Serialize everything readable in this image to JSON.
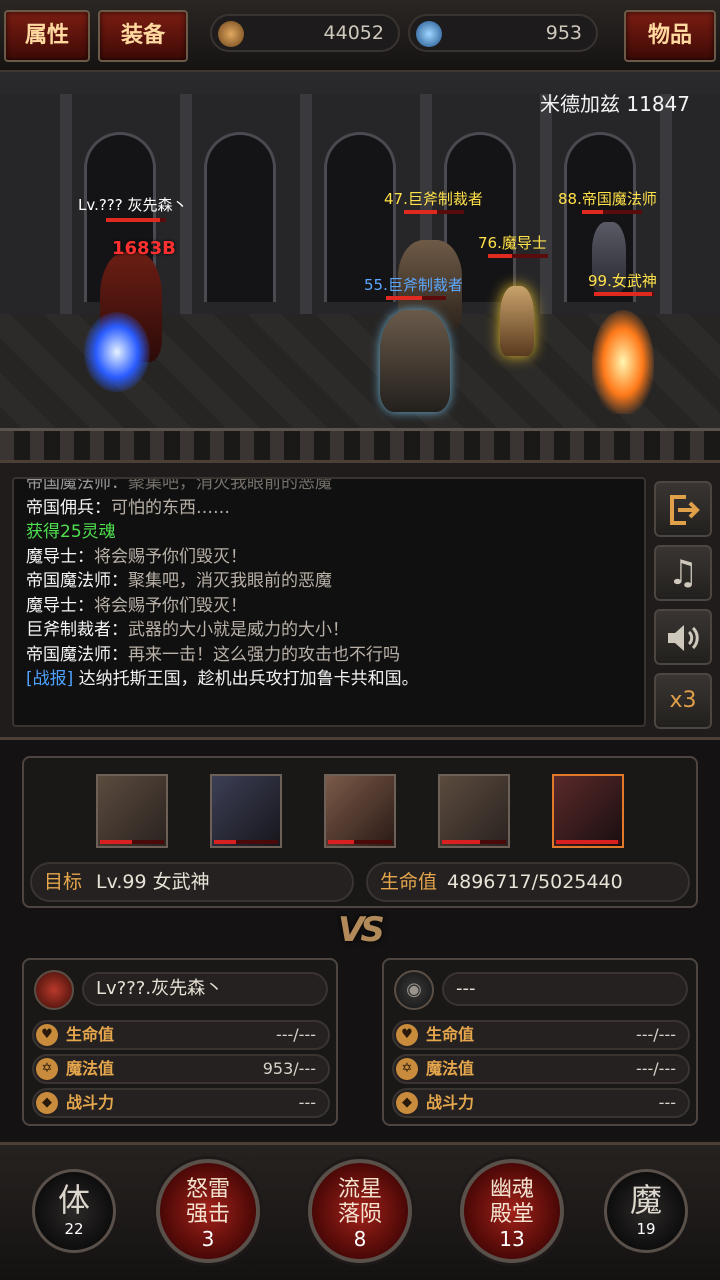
{
  "topbar": {
    "attr_button": "属性",
    "equip_button": "装备",
    "items_button": "物品",
    "currency_gold": "44052",
    "currency_mana": "953"
  },
  "scene": {
    "location": "米德加兹 11847",
    "player_label": "Lv.??? 灰先森丶",
    "damage_text": "1683B",
    "enemies": [
      {
        "label": "47.巨斧制裁者",
        "color": "#ffe14a"
      },
      {
        "label": "88.帝国魔法师",
        "color": "#ffe14a"
      },
      {
        "label": "76.魔导士",
        "color": "#ffe14a"
      },
      {
        "label": "55.巨斧制裁者",
        "color": "#5aa8ff"
      },
      {
        "label": "99.女武神",
        "color": "#ffe14a"
      }
    ]
  },
  "log": {
    "lines": [
      {
        "speaker": "帝国魔法师：",
        "text": "聚集吧，消灭我眼前的恶魔",
        "type": "talk"
      },
      {
        "speaker": "帝国佣兵：",
        "text": "可怕的东西……",
        "type": "talk"
      },
      {
        "speaker": "",
        "text": "获得25灵魂",
        "type": "gain"
      },
      {
        "speaker": "魔导士：",
        "text": "将会赐予你们毁灭！",
        "type": "talk"
      },
      {
        "speaker": "帝国魔法师：",
        "text": "聚集吧，消灭我眼前的恶魔",
        "type": "talk"
      },
      {
        "speaker": "魔导士：",
        "text": "将会赐予你们毁灭！",
        "type": "talk"
      },
      {
        "speaker": "巨斧制裁者：",
        "text": "武器的大小就是威力的大小！",
        "type": "talk"
      },
      {
        "speaker": "帝国魔法师：",
        "text": "再来一击！这么强力的攻击也不行吗",
        "type": "talk"
      },
      {
        "speaker": "[战报]",
        "text": " 达纳托斯王国，趁机出兵攻打加鲁卡共和国。",
        "type": "news"
      }
    ],
    "speed_label": "x3"
  },
  "target": {
    "target_label": "目标",
    "target_value": "Lv.99 女武神",
    "hp_label": "生命值",
    "hp_value": "4896717/5025440",
    "portraits": [
      {
        "name": "巨斧制裁者",
        "hp": 0.5
      },
      {
        "name": "帝国魔法师",
        "hp": 0.35
      },
      {
        "name": "魔导士",
        "hp": 0.4
      },
      {
        "name": "巨斧制裁者",
        "hp": 0.6
      },
      {
        "name": "女武神",
        "hp": 0.97
      }
    ]
  },
  "vs_label": "VS",
  "player": {
    "name": "Lv???.灰先森丶",
    "hp_label": "生命值",
    "hp_value": "---/---",
    "mp_label": "魔法值",
    "mp_value": "953/---",
    "power_label": "战斗力",
    "power_value": "---"
  },
  "opponent": {
    "name": "---",
    "hp_label": "生命值",
    "hp_value": "---/---",
    "mp_label": "魔法值",
    "mp_value": "---/---",
    "power_label": "战斗力",
    "power_value": "---"
  },
  "skills": [
    {
      "name": "体",
      "count": "22"
    },
    {
      "name": "怒雷强击",
      "count": "3"
    },
    {
      "name": "流星落陨",
      "count": "8"
    },
    {
      "name": "幽魂殿堂",
      "count": "13"
    },
    {
      "name": "魔",
      "count": "19"
    }
  ],
  "colors": {
    "accent_gold": "#e5a64c",
    "button_red": "#7a1d12",
    "gain_green": "#4ee04e",
    "news_blue": "#4ea2ff"
  }
}
